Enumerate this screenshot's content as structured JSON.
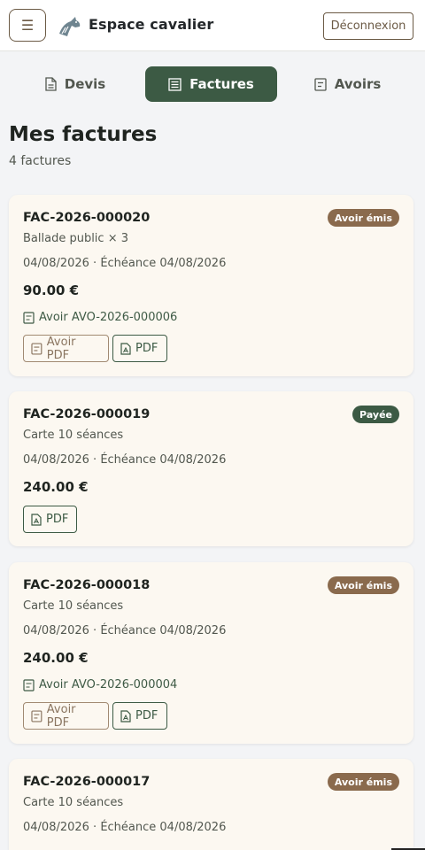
{
  "header": {
    "title": "Espace cavalier",
    "logout_label": "Déconnexion",
    "menu_icon": "hamburger-icon",
    "logo_icon": "horse-head-logo"
  },
  "tabs": [
    {
      "label": "Devis",
      "icon": "document-icon",
      "active": false
    },
    {
      "label": "Factures",
      "icon": "receipt-icon",
      "active": true
    },
    {
      "label": "Avoirs",
      "icon": "credit-note-icon",
      "active": false
    }
  ],
  "page": {
    "title": "Mes factures",
    "count": "4 factures"
  },
  "invoices": [
    {
      "number": "FAC-2026-000020",
      "status": "Avoir émis",
      "description": "Ballade public × 3",
      "dates": "04/08/2026 · Échéance 04/08/2026",
      "amount": "90.00 €",
      "avoir": "Avoir AVO-2026-000006",
      "avoir_pdf_label": "Avoir PDF",
      "pdf_label": "PDF"
    },
    {
      "number": "FAC-2026-000019",
      "status": "Payée",
      "description": "Carte 10 séances",
      "dates": "04/08/2026 · Échéance 04/08/2026",
      "amount": "240.00 €",
      "pdf_label": "PDF"
    },
    {
      "number": "FAC-2026-000018",
      "status": "Avoir émis",
      "description": "Carte 10 séances",
      "dates": "04/08/2026 · Échéance 04/08/2026",
      "amount": "240.00 €",
      "avoir": "Avoir AVO-2026-000004",
      "avoir_pdf_label": "Avoir PDF",
      "pdf_label": "PDF"
    },
    {
      "number": "FAC-2026-000017",
      "status": "Avoir émis",
      "description": "Carte 10 séances",
      "dates": "04/08/2026 · Échéance 04/08/2026"
    }
  ],
  "colors": {
    "primary": "#3c5a44",
    "brown": "#8a6a4d",
    "card": "#fcf8f1",
    "background": "#f3f4f6"
  }
}
